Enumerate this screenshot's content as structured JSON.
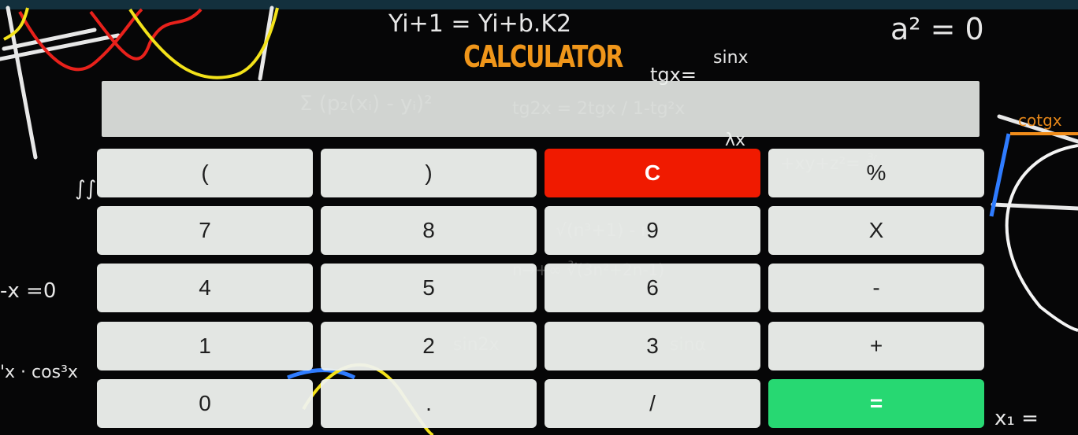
{
  "app": {
    "title": "CALCULATOR"
  },
  "display": {
    "value": ""
  },
  "keys": [
    {
      "label": "("
    },
    {
      "label": ")"
    },
    {
      "label": "C"
    },
    {
      "label": "%"
    },
    {
      "label": "7"
    },
    {
      "label": "8"
    },
    {
      "label": "9"
    },
    {
      "label": "X"
    },
    {
      "label": "4"
    },
    {
      "label": "5"
    },
    {
      "label": "6"
    },
    {
      "label": "-"
    },
    {
      "label": "1"
    },
    {
      "label": "2"
    },
    {
      "label": "3"
    },
    {
      "label": "+"
    },
    {
      "label": "0"
    },
    {
      "label": "."
    },
    {
      "label": "/"
    },
    {
      "label": "="
    }
  ],
  "colors": {
    "title": "#f0961a",
    "clear_key": "#f01a00",
    "equals_key": "#27d872",
    "key": "#eff2ef",
    "background": "#060607"
  },
  "background": {
    "type": "chalkboard-math-formulas"
  }
}
